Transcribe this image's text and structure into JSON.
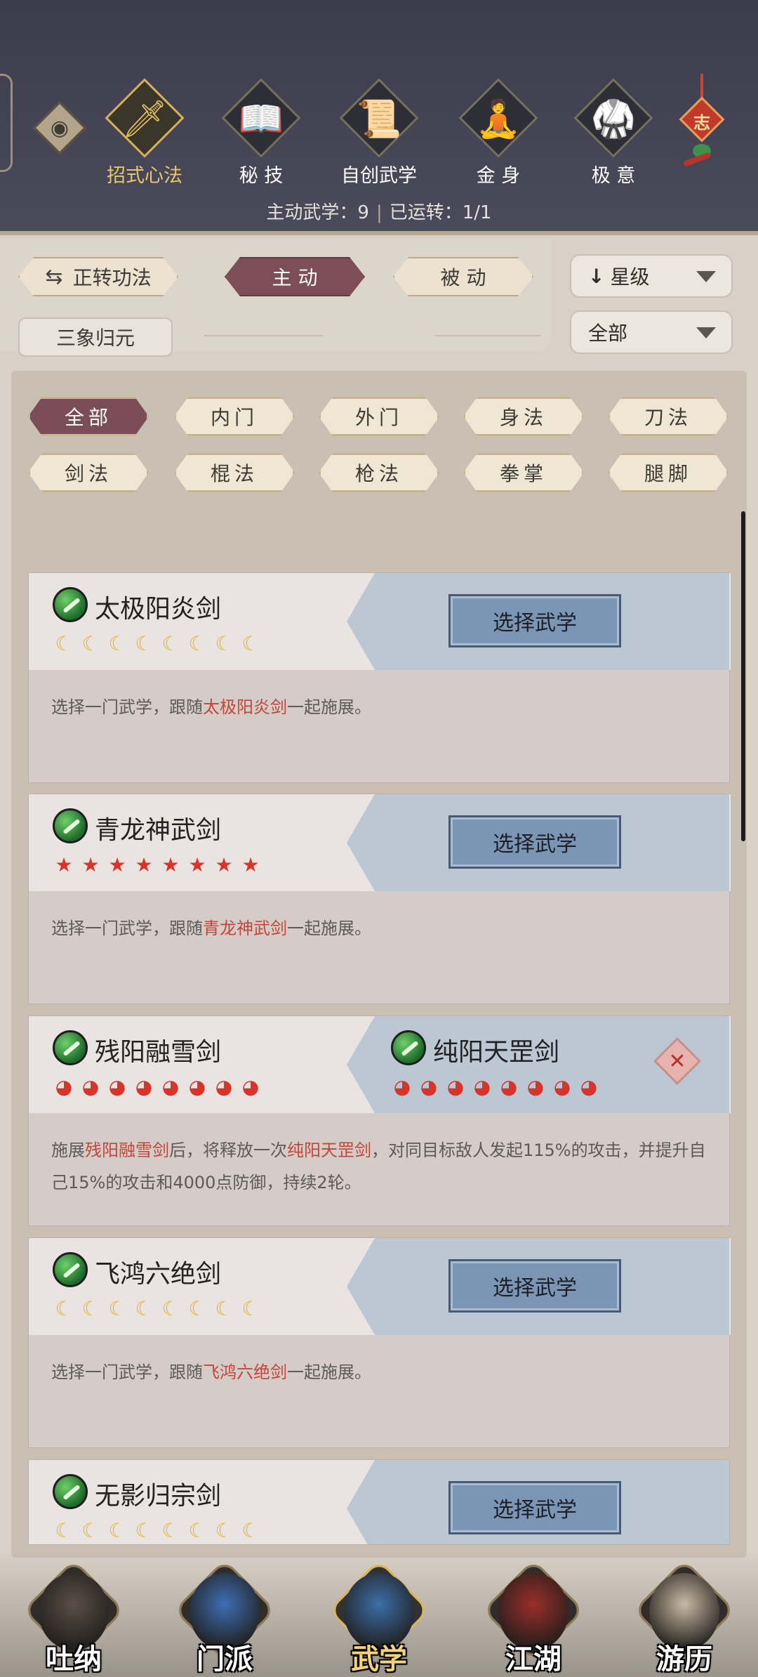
{
  "top_tabs": [
    {
      "label": "招式心法",
      "glyph": "🗡",
      "active": true
    },
    {
      "label": "秘 技",
      "glyph": "📖",
      "active": false
    },
    {
      "label": "自创武学",
      "glyph": "📜",
      "active": false
    },
    {
      "label": "金 身",
      "glyph": "🧘",
      "active": false
    },
    {
      "label": "极 意",
      "glyph": "🥋",
      "active": false
    }
  ],
  "knot_char": "志",
  "stats": {
    "active_label": "主动武学：9",
    "running_label": "已运转：1/1"
  },
  "filters": {
    "convert_label": "正转功法",
    "convert_icon": "⇆",
    "active_label": "主 动",
    "passive_label": "被 动",
    "reset_label": "三象归元",
    "sort_value": "星级",
    "sort_arrow": "↓",
    "scope_value": "全部"
  },
  "categories": [
    "全部",
    "内门",
    "外门",
    "身法",
    "刀法",
    "剑法",
    "棍法",
    "枪法",
    "拳掌",
    "腿脚"
  ],
  "cards": [
    {
      "name": "太极阳炎剑",
      "star_type": "gold",
      "stars": 8,
      "button": "选择武学",
      "desc_pre": "选择一门武学，跟随",
      "desc_hl": "太极阳炎剑",
      "desc_post": "一起施展。"
    },
    {
      "name": "青龙神武剑",
      "star_type": "red",
      "stars": 8,
      "button": "选择武学",
      "desc_pre": "选择一门武学，跟随",
      "desc_hl": "青龙神武剑",
      "desc_post": "一起施展。"
    },
    {
      "name": "残阳融雪剑",
      "partner": "纯阳天罡剑",
      "star_type": "flame",
      "stars": 8,
      "partner_stars": 8,
      "desc_a": "施展",
      "desc_hl1": "残阳融雪剑",
      "desc_b": "后，将释放一次",
      "desc_hl2": "纯阳天罡剑",
      "desc_c": "，对同目标敌人发起115%的攻击，并提升自己15%的攻击和4000点防御，持续2轮。"
    },
    {
      "name": "飞鸿六绝剑",
      "star_type": "gold",
      "stars": 8,
      "button": "选择武学",
      "desc_pre": "选择一门武学，跟随",
      "desc_hl": "飞鸿六绝剑",
      "desc_post": "一起施展。"
    },
    {
      "name": "无影归宗剑",
      "star_type": "gold",
      "stars": 8,
      "button": "选择武学"
    }
  ],
  "bottom_nav": [
    {
      "label": "吐纳",
      "active": false,
      "color": "#5a4f45"
    },
    {
      "label": "门派",
      "active": false,
      "color": "#3f6fb3"
    },
    {
      "label": "武学",
      "active": true,
      "color": "#3d6fa8"
    },
    {
      "label": "江湖",
      "active": false,
      "color": "#9a2f2a"
    },
    {
      "label": "游历",
      "active": false,
      "color": "#c9b9a3"
    }
  ]
}
